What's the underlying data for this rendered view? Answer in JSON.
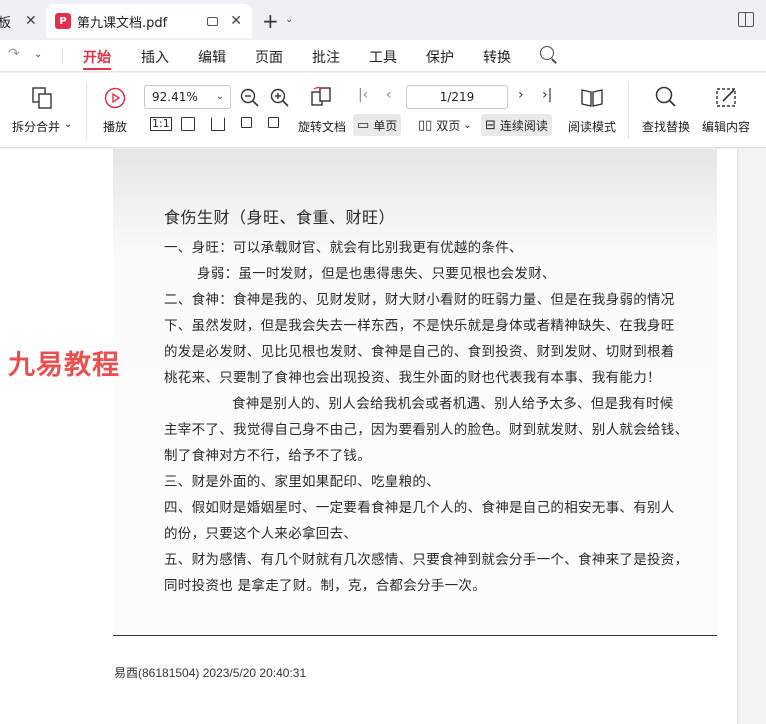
{
  "titlebar": {
    "prev_tab_label": "板",
    "active_tab_title": "第九课文档.pdf",
    "close_glyph": "✕",
    "new_tab_glyph": "+",
    "dropdown_glyph": "⌄"
  },
  "menubar": {
    "redo_glyph": "↷",
    "items": [
      "开始",
      "插入",
      "编辑",
      "页面",
      "批注",
      "工具",
      "保护",
      "转换"
    ],
    "active_index": 0,
    "accent_color": "#e0334b"
  },
  "toolbar": {
    "split_merge_label": "拆分合并",
    "play_label": "播放",
    "zoom_value": "92.41%",
    "page_indicator": "1/219",
    "rotate_label": "旋转文档",
    "single_page_label": "单页",
    "double_page_label": "双页",
    "continuous_label": "连续阅读",
    "read_mode_label": "阅读模式",
    "find_replace_label": "查找替换",
    "edit_content_label": "编辑内容",
    "actual_size_glyph": "1:1"
  },
  "document": {
    "title": "食伤生财（身旺、食重、财旺）",
    "lines": [
      "一、身旺：可以承载财官、就会有比别我更有优越的条件、",
      "身弱：虽一时发财，但是也患得患失、只要见根也会发财、",
      "二、食神：食神是我的、见财发财，财大财小看财的旺弱力量、但是在我身弱的情况",
      "下、虽然发财，但是我会失去一样东西，不是快乐就是身体或者精神缺失、在我身旺",
      "的发是必发财、见比见根也发财、食神是自己的、食到投资、财到发财、切财到根着",
      "桃花来、只要制了食神也会出现投资、我生外面的财也代表我有本事、我有能力！",
      "食神是别人的、别人会给我机会或者机遇、别人给予太多、但是我有时候",
      "主宰不了、我觉得自己身不由己，因为要看别人的脸色。财到就发财、别人就会给钱、",
      "制了食神对方不行，给予不了钱。",
      "三、财是外面的、家里如果配印、吃皇粮的、",
      "四、假如财是婚姻星时、一定要看食神是几个人的、食神是自己的相安无事、有别人",
      "的份，只要这个人来必拿回去、",
      "五、财为感情、有几个财就有几次感情、只要食神到就会分手一个、食神来了是投资，",
      "同时投资也 是拿走了财。制，克，合都会分手一次。"
    ],
    "watermark": "九易教程",
    "footer_stamp": "易酉(86181504) 2023/5/20 20:40:31"
  }
}
